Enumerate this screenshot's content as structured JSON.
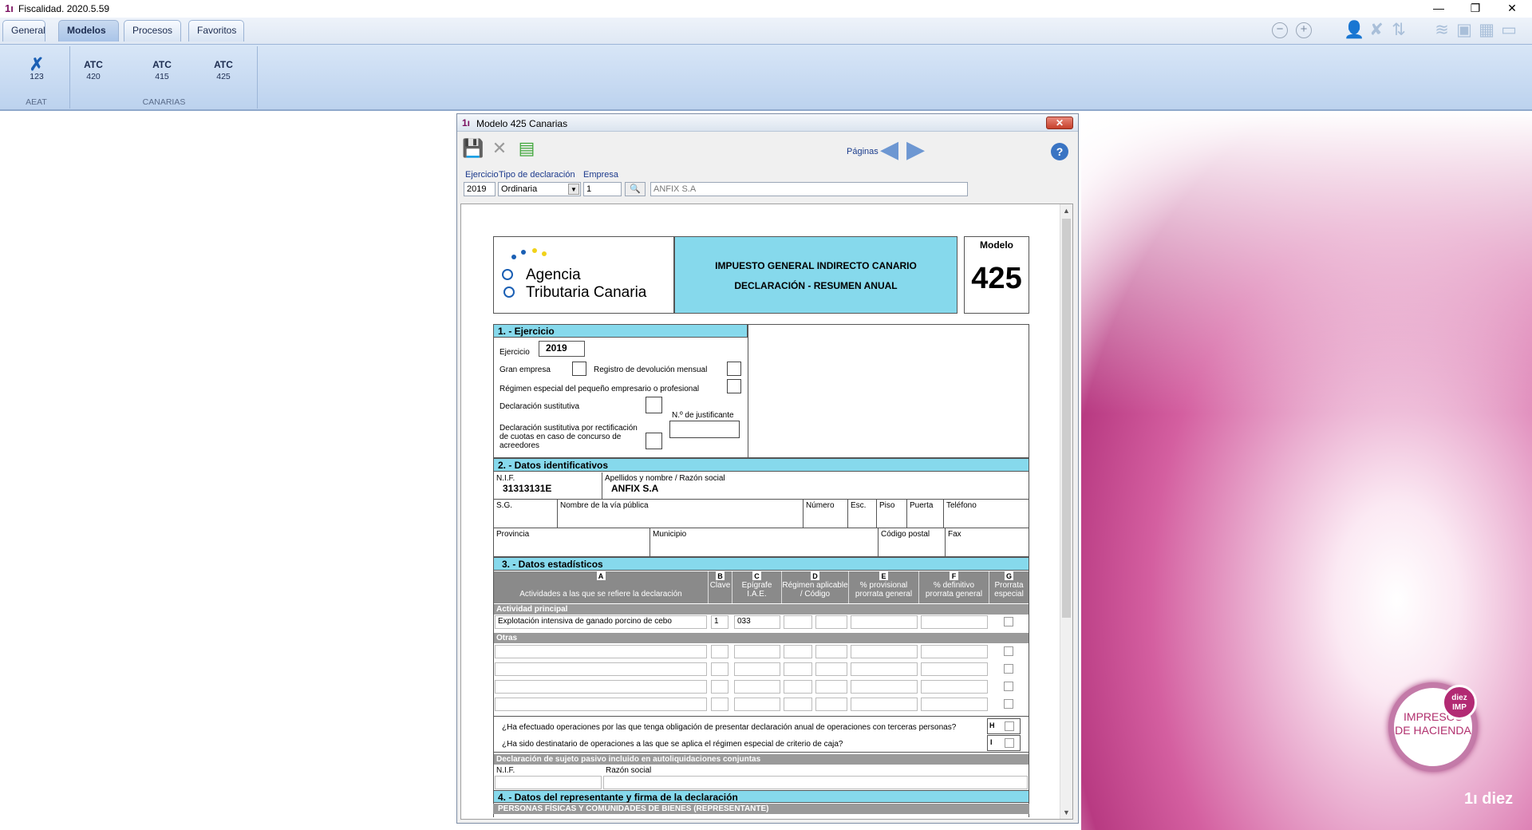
{
  "app": {
    "title": "Fiscalidad. 2020.5.59"
  },
  "tabs": [
    "General",
    "Modelos",
    "Procesos",
    "Favoritos"
  ],
  "ribbon": {
    "groups": [
      {
        "label": "AEAT"
      },
      {
        "label": "CANARIAS"
      }
    ],
    "items": [
      {
        "icon": "aeat-icon",
        "title": "",
        "code": "123"
      },
      {
        "icon": "atc-icon",
        "title": "ATC",
        "code": "420"
      },
      {
        "icon": "atc-icon",
        "title": "ATC",
        "code": "415"
      },
      {
        "icon": "atc-icon",
        "title": "ATC",
        "code": "425"
      }
    ]
  },
  "dialog": {
    "title": "Modelo 425 Canarias",
    "paginas": "Páginas",
    "fields": {
      "ejercicio_label": "Ejercicio",
      "ejercicio": "2019",
      "tipo_label": "Tipo de declaración",
      "tipo": "Ordinaria",
      "empresa_label": "Empresa",
      "empresa": "1",
      "empresa_nombre": "ANFIX S.A"
    }
  },
  "form": {
    "agency_line1": "Agencia",
    "agency_line2": "Tributaria Canaria",
    "tax_title1": "IMPUESTO GENERAL INDIRECTO CANARIO",
    "tax_title2": "DECLARACIÓN - RESUMEN ANUAL",
    "modelo_label": "Modelo",
    "modelo_num": "425",
    "s1": {
      "title": "1. - Ejercicio",
      "ejercicio_label": "Ejercicio",
      "ejercicio": "2019",
      "gran_empresa": "Gran empresa",
      "registro": "Registro de devolución mensual",
      "regimen": "Régimen especial del pequeño empresario o profesional",
      "sustitutiva": "Declaración sustitutiva",
      "n_justificante": "N.º de justificante",
      "rectificacion1": "Declaración sustitutiva por rectificación",
      "rectificacion2": "de cuotas en caso de concurso de",
      "rectificacion3": "acreedores"
    },
    "s2": {
      "title": "2. - Datos identificativos",
      "nif_label": "N.I.F.",
      "nif": "31313131E",
      "nombre_label": "Apellidos y nombre / Razón social",
      "nombre": "ANFIX S.A",
      "sg": "S.G.",
      "via": "Nombre de la vía pública",
      "numero": "Número",
      "esc": "Esc.",
      "piso": "Piso",
      "puerta": "Puerta",
      "telefono": "Teléfono",
      "provincia": "Provincia",
      "municipio": "Municipio",
      "cp": "Código postal",
      "fax": "Fax"
    },
    "s3": {
      "title": "3. - Datos estadísticos",
      "cols": [
        {
          "key": "A",
          "label": "Actividades a las que se refiere la declaración"
        },
        {
          "key": "B",
          "label": "Clave"
        },
        {
          "key": "C",
          "label": "Epígrafe I.A.E."
        },
        {
          "key": "D",
          "label": "Régimen aplicable / Código"
        },
        {
          "key": "E",
          "label": "% provisional prorrata general"
        },
        {
          "key": "F",
          "label": "% definitivo prorrata general"
        },
        {
          "key": "G",
          "label": "Prorrata especial"
        }
      ],
      "principal_label": "Actividad principal",
      "principal": {
        "actividad": "Explotación intensiva de ganado porcino de cebo",
        "clave": "1",
        "epigrafe": "033"
      },
      "otras_label": "Otras",
      "q1": "¿Ha efectuado operaciones por las que tenga obligación de presentar declaración anual de operaciones con terceras personas?",
      "q1_key": "H",
      "q2": "¿Ha sido destinatario de operaciones a las que se aplica el régimen especial de criterio de caja?",
      "q2_key": "I",
      "sujeto_label": "Declaración de sujeto pasivo incluido en autoliquidaciones conjuntas",
      "sujeto_nif": "N.I.F.",
      "sujeto_razon": "Razón social"
    },
    "s4": {
      "title": "4. - Datos del representante y firma de la declaración",
      "sub": "PERSONAS FÍSICAS Y COMUNIDADES DE BIENES (REPRESENTANTE)"
    }
  },
  "brand": {
    "imp_line1": "IMPRESOS",
    "imp_line2": "DE HACIENDA",
    "badge1": "diez",
    "badge2": "IMP",
    "logo": "diez"
  },
  "colors": {
    "cyan": "#86d9ec",
    "grey_header": "#8a8a8a",
    "ribbon": "#bcd2ee",
    "brand": "#b1306e"
  }
}
